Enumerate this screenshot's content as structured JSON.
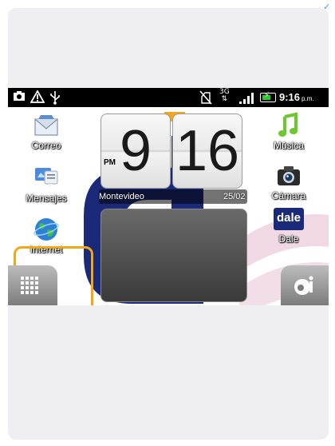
{
  "status_bar": {
    "network_type": "3G",
    "time": "9:16",
    "time_suffix": "p.m."
  },
  "clock_widget": {
    "hour": "9",
    "minute": "16",
    "ampm": "PM",
    "city": "Montevideo",
    "date": "25/02"
  },
  "apps": {
    "correo": "Correo",
    "mensajes": "Mensajes",
    "internet": "Internet",
    "musica": "Música",
    "camara": "Cámara",
    "dale": "Dale",
    "dale_icon_text": "dale"
  },
  "colors": {
    "highlight": "#f1a815",
    "logo_blue": "#1b2a78"
  }
}
